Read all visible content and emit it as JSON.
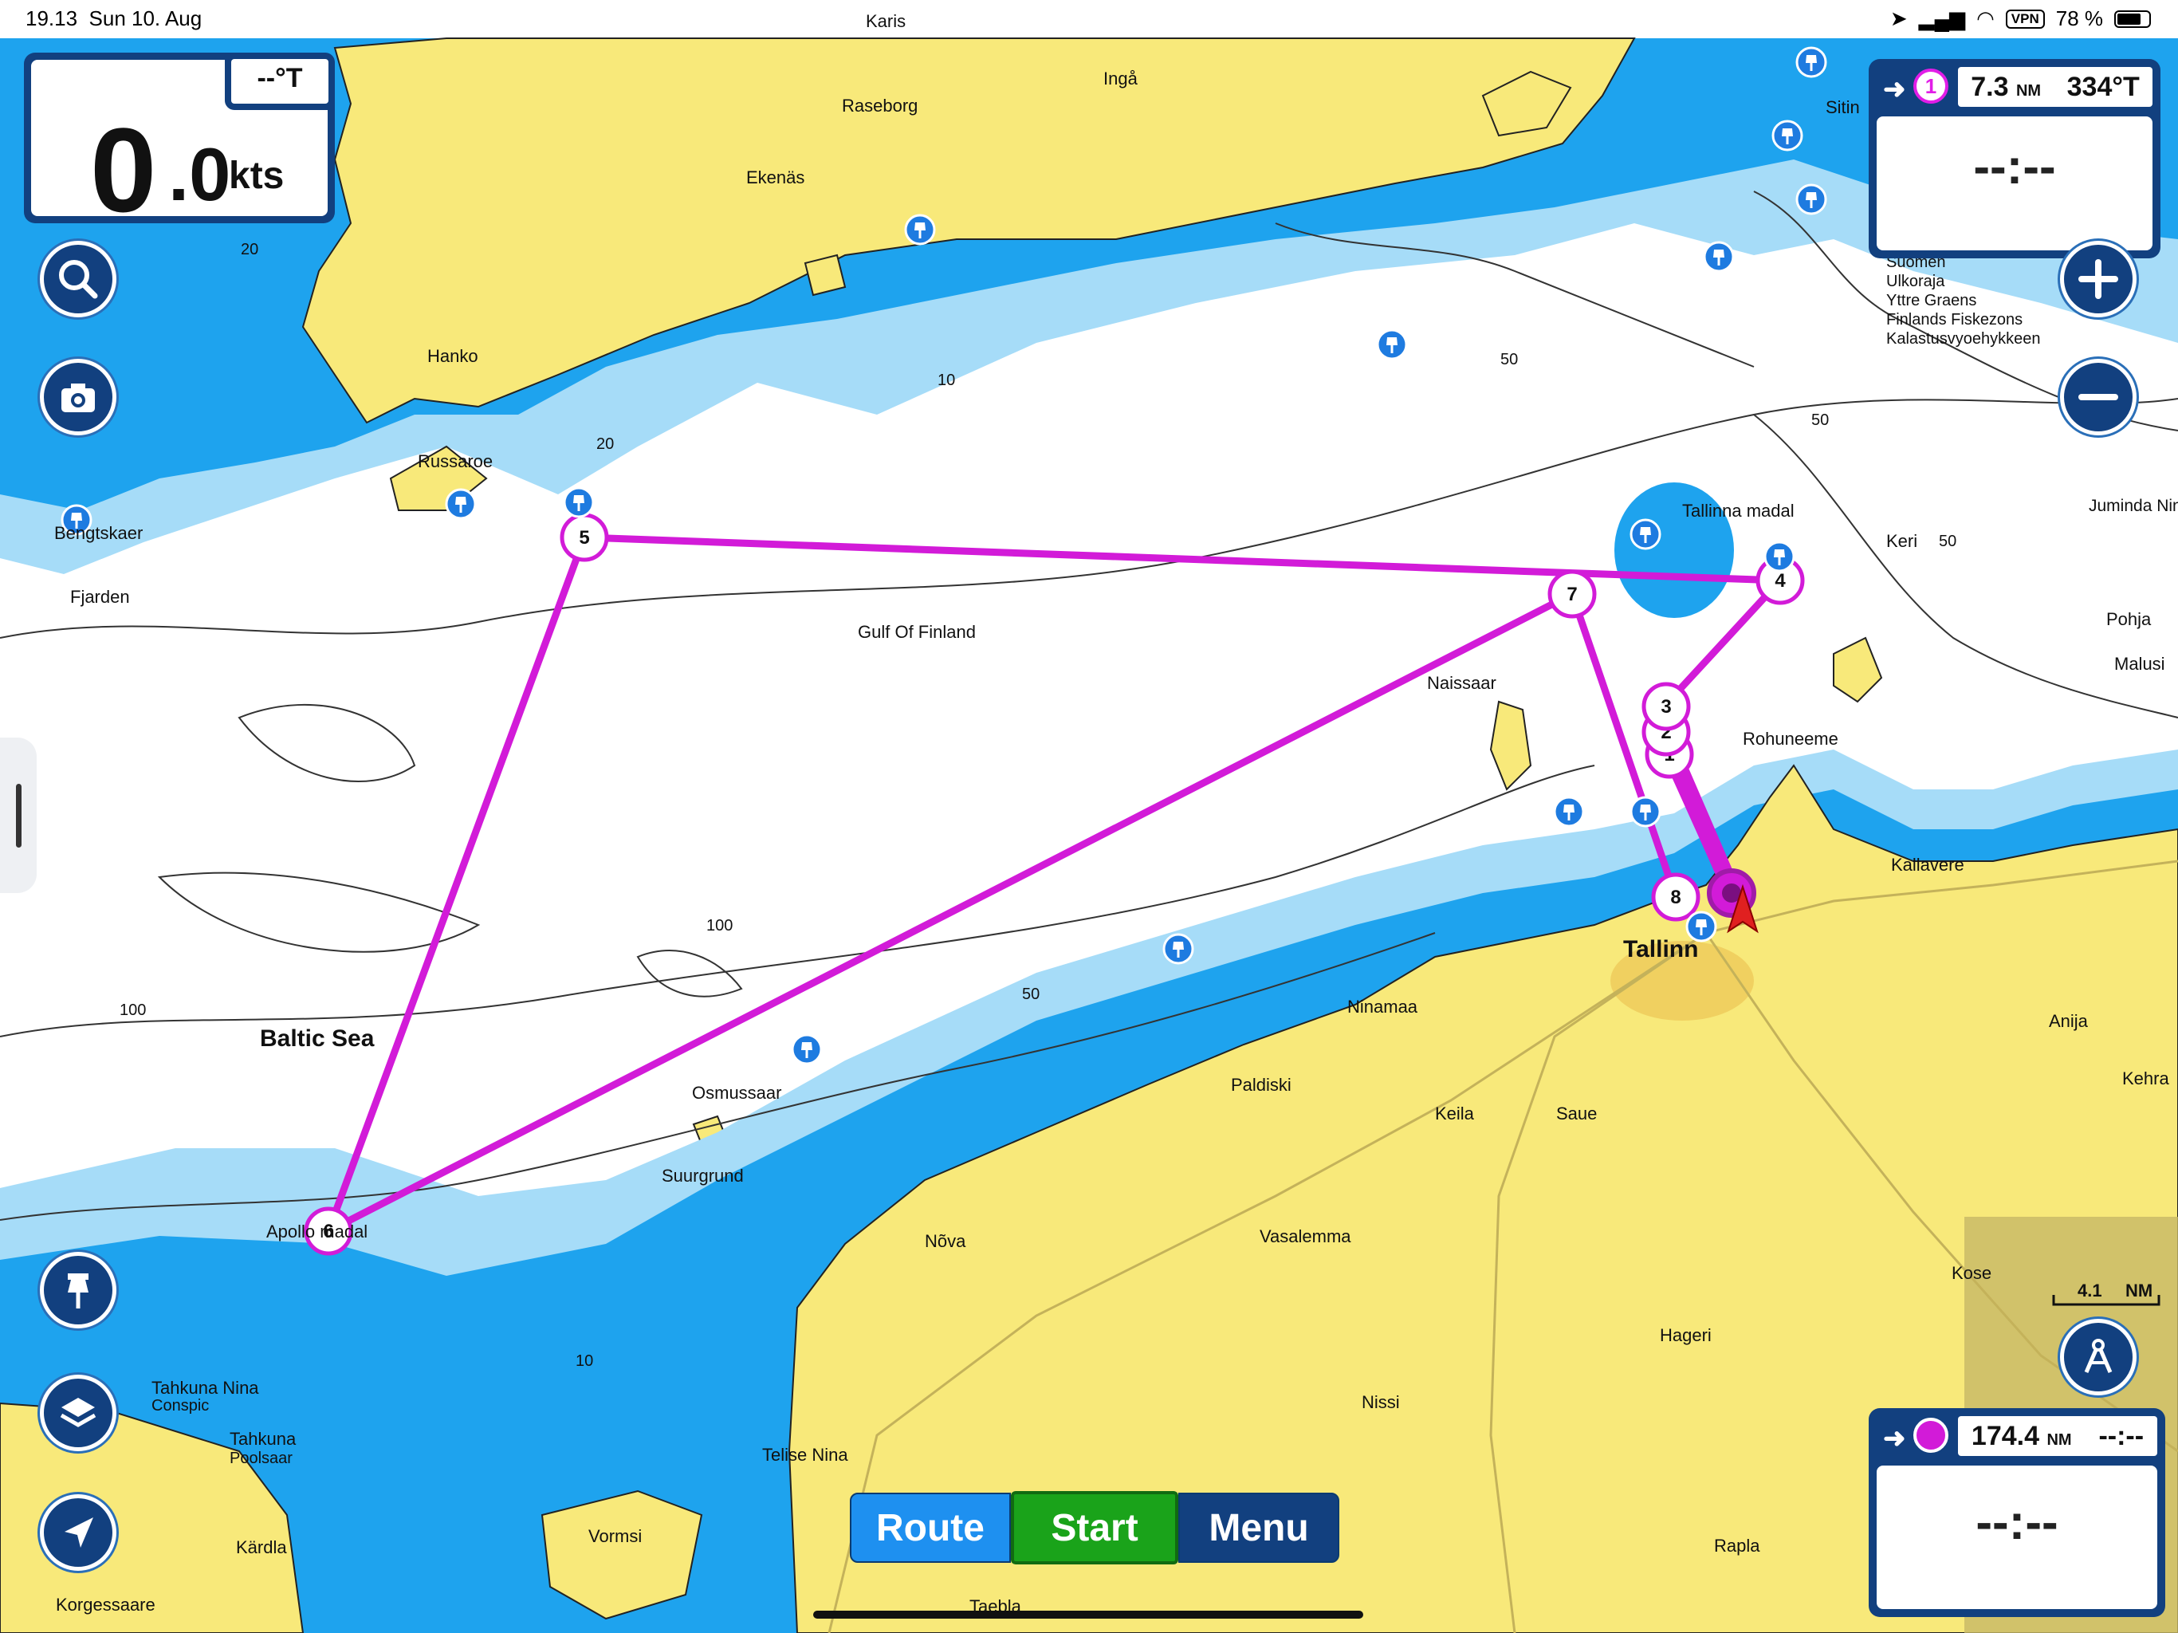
{
  "status_bar": {
    "time": "19.13",
    "date": "Sun 10. Aug",
    "vpn": "VPN",
    "battery": "78 %"
  },
  "speed": {
    "integer": "0",
    "decimal": ".0",
    "unit": "kts",
    "cog": "--°T"
  },
  "next_waypoint": {
    "number": "1",
    "distance": "7.3",
    "distance_unit": "NM",
    "bearing": "334°T",
    "eta": "--:--"
  },
  "destination": {
    "distance": "174.4",
    "distance_unit": "NM",
    "time": "--:--",
    "eta": "--:--"
  },
  "scale": {
    "value": "4.1",
    "unit": "NM"
  },
  "bottom_bar": {
    "route": "Route",
    "start": "Start",
    "menu": "Menu"
  },
  "icons": [
    "search-icon",
    "camera-icon",
    "zoom-in-icon",
    "zoom-out-icon",
    "pin-icon",
    "layers-icon",
    "locate-icon",
    "compass-icon",
    "marina-icon",
    "boat-icon"
  ],
  "colors": {
    "land": "#f8e97a",
    "shallow": "#1ea3ee",
    "mid": "#a6dcf8",
    "deep": "#ffffff",
    "route": "#d21bd8",
    "panel": "#12407f",
    "start": "#1aa31a"
  },
  "labels": {
    "karis": "Karis",
    "inga": "Ingå",
    "raseborg": "Raseborg",
    "ekenas": "Ekenäs",
    "sitin": "Sitin",
    "hanko": "Hanko",
    "russaroe": "Russaroe",
    "bengtskaer": "Bengtskaer",
    "fjarden": "Fjarden",
    "gulf": "Gulf Of Finland",
    "suomen": "Suomen",
    "ulkoraja": "Ulkoraja",
    "yttre": "Yttre Graens",
    "finlands": "Finlands Fiskezons",
    "kalastus": "Kalastusvyoehykkeen",
    "juminda": "Juminda Nina",
    "keri": "Keri",
    "pohja": "Pohja",
    "malusi": "Malusi",
    "tallinna": "Tallinna madal",
    "naissaar": "Naissaar",
    "rohuneeme": "Rohuneeme",
    "kallavere": "Kallavere",
    "tallinn": "Tallinn",
    "ninamaa": "Ninamaa",
    "anija": "Anija",
    "kehra": "Kehra",
    "paldiski": "Paldiski",
    "keila": "Keila",
    "saue": "Saue",
    "baltic": "Baltic Sea",
    "osmussaar": "Osmussaar",
    "suurgrund": "Suurgrund",
    "apollo": "Apollo madal",
    "nova": "Nõva",
    "vasalemma": "Vasalemma",
    "kose": "Kose",
    "hageri": "Hageri",
    "nissi": "Nissi",
    "tahkuna1": "Tahkuna Nina",
    "tahkuna1b": "Conspic",
    "tahkuna2": "Tahkuna",
    "tahkuna2b": "Poolsaar",
    "telise": "Telise Nina",
    "vormsi": "Vormsi",
    "rapla": "Rapla",
    "kardla": "Kärdla",
    "korgessaare": "Korgessaare",
    "taebla": "Taebla"
  },
  "depth_labels": {
    "d20a": "20",
    "d20b": "20",
    "d10a": "10",
    "d50a": "50",
    "d50b": "50",
    "d50c": "50",
    "d100a": "100",
    "d100b": "100",
    "d50d": "50",
    "d10b": "10"
  },
  "route_waypoints": [
    "1",
    "2",
    "3",
    "4",
    "5",
    "6",
    "7",
    "8"
  ]
}
